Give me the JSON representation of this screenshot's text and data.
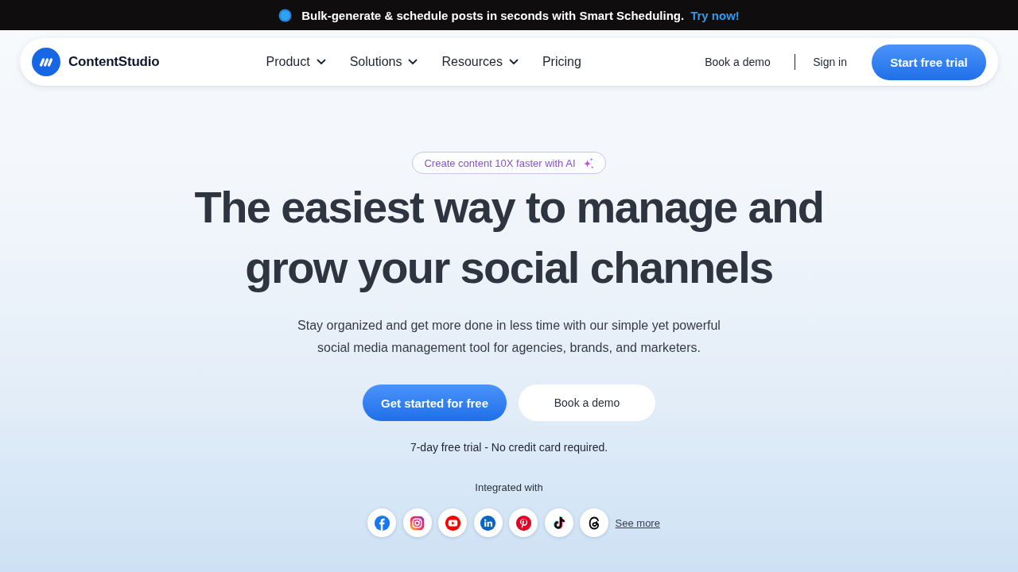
{
  "announcement": {
    "text": "Bulk-generate & schedule posts in seconds with Smart Scheduling.",
    "link": "Try now!"
  },
  "nav": {
    "brand": "ContentStudio",
    "menu": [
      {
        "label": "Product",
        "dropdown": true
      },
      {
        "label": "Solutions",
        "dropdown": true
      },
      {
        "label": "Resources",
        "dropdown": true
      },
      {
        "label": "Pricing",
        "dropdown": false
      }
    ],
    "book_demo": "Book a demo",
    "sign_in": "Sign in",
    "cta": "Start free trial"
  },
  "hero": {
    "badge": "Create content 10X faster with AI",
    "title": "The easiest way to manage and grow your social channels",
    "subtitle": "Stay organized and get more done in less time with our simple yet powerful social media management tool for agencies, brands, and marketers.",
    "primary_button": "Get started for free",
    "secondary_button": "Book a demo",
    "note": "7-day free trial - No credit card required.",
    "integrations_label": "Integrated with",
    "see_more": "See more"
  }
}
